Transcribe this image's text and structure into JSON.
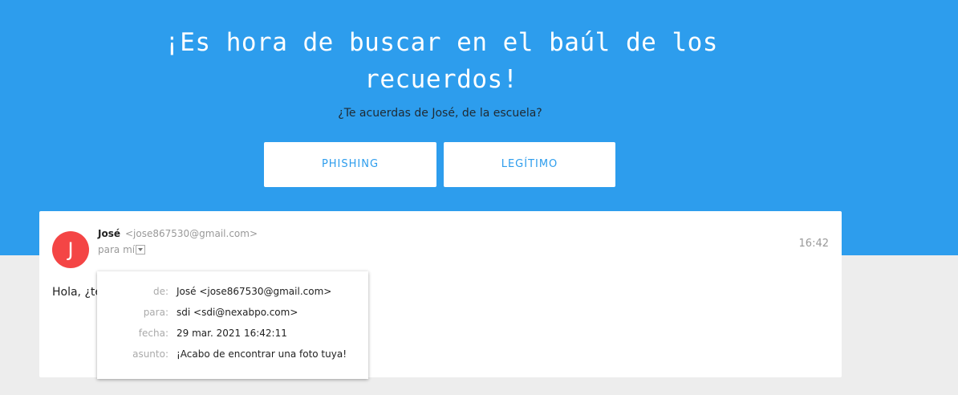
{
  "hero": {
    "title": "¡Es hora de buscar en el baúl de los recuerdos!",
    "subtitle": "¿Te acuerdas de José, de la escuela?",
    "buttons": {
      "phishing": "PHISHING",
      "legit": "LEGÍTIMO"
    }
  },
  "email": {
    "avatar_letter": "J",
    "sender_name": "José",
    "sender_email": "<jose867530@gmail.com>",
    "to_label": "para mí",
    "time": "16:42",
    "body_preview": "Hola, ¿te"
  },
  "details": {
    "rows": [
      {
        "label": "de:",
        "value": "José <jose867530@gmail.com>"
      },
      {
        "label": "para:",
        "value": "sdi <sdi@nexabpo.com>"
      },
      {
        "label": "fecha:",
        "value": "29 mar. 2021 16:42:11"
      },
      {
        "label": "asunto:",
        "value": "¡Acabo de encontrar una foto tuya!"
      }
    ]
  },
  "colors": {
    "hero_background": "#2d9ded",
    "page_background": "#ededed",
    "accent": "#2d9ded",
    "avatar": "#f44545"
  },
  "icons": {
    "details_toggle": "chevron-down-icon"
  }
}
